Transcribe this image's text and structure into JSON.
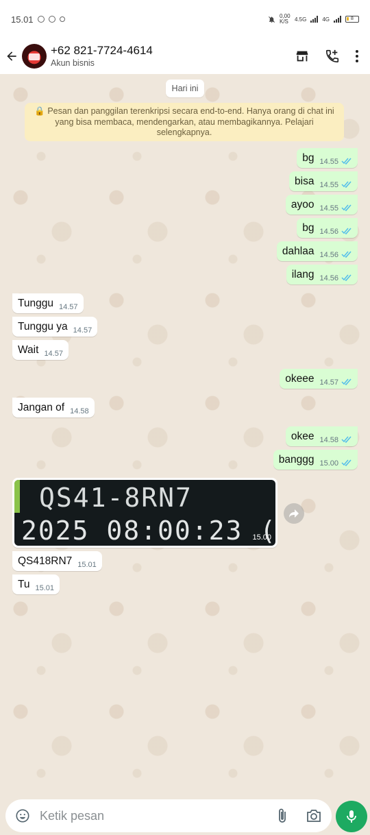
{
  "status_bar": {
    "time": "15.01",
    "net_speed": "0,00 K/S",
    "net_type1": "4.5G",
    "net_type2": "4G",
    "battery": "8"
  },
  "header": {
    "contact": "+62 821-7724-4614",
    "subtitle": "Akun bisnis"
  },
  "chat": {
    "date_chip": "Hari ini",
    "notice": "🔒 Pesan dan panggilan terenkripsi secara end-to-end. Hanya orang di chat ini yang bisa membaca, mendengarkan, atau membagikannya. Pelajari selengkapnya.",
    "messages": [
      {
        "dir": "out",
        "text": "bg",
        "time": "14.55",
        "read": true
      },
      {
        "dir": "out",
        "text": "bisa",
        "time": "14.55",
        "read": true
      },
      {
        "dir": "out",
        "text": "ayoo",
        "time": "14.55",
        "read": true
      },
      {
        "dir": "out",
        "text": "bg",
        "time": "14.56",
        "read": true
      },
      {
        "dir": "out",
        "text": "dahlaa",
        "time": "14.56",
        "read": true
      },
      {
        "dir": "out",
        "text": "ilang",
        "time": "14.56",
        "read": true
      },
      {
        "dir": "in",
        "text": "Tunggu",
        "time": "14.57"
      },
      {
        "dir": "in",
        "text": "Tunggu ya",
        "time": "14.57"
      },
      {
        "dir": "in",
        "text": "Wait",
        "time": "14.57"
      },
      {
        "dir": "out",
        "text": "okeee",
        "time": "14.57",
        "read": true
      },
      {
        "dir": "in",
        "text": "Jangan of",
        "time": "14.58"
      },
      {
        "dir": "out",
        "text": "okee",
        "time": "14.58",
        "read": true
      },
      {
        "dir": "out",
        "text": "banggg",
        "time": "15.00",
        "read": true
      },
      {
        "dir": "in",
        "text": "QS418RN7",
        "time": "15.01"
      },
      {
        "dir": "in",
        "text": "Tu",
        "time": "15.01"
      }
    ],
    "image_message": {
      "line1": "QS41-8RN7",
      "line2": "2025  08:00:23 (",
      "time": "15.00"
    }
  },
  "input": {
    "placeholder": "Ketik pesan"
  },
  "colors": {
    "out_bubble": "#d9fdd3",
    "in_bubble": "#ffffff",
    "tick_read": "#53bdeb",
    "accent": "#1daa61",
    "notice_bg": "#fbeec1"
  }
}
